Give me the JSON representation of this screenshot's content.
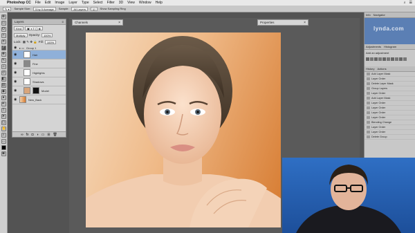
{
  "menubar": {
    "app_name": "Photoshop CC",
    "items": [
      "File",
      "Edit",
      "Image",
      "Layer",
      "Type",
      "Select",
      "Filter",
      "3D",
      "View",
      "Window",
      "Help"
    ]
  },
  "options": {
    "sample_size_label": "Sample Size:",
    "sample_size_value": "5 by 5 Average",
    "sample_label": "Sample:",
    "sample_value": "All Layers",
    "ring_label": "Show Sampling Ring"
  },
  "tabs": {
    "layers": "Layers",
    "channels": "Channels",
    "properties": "Properties"
  },
  "layers_panel": {
    "kind_value": "Kind",
    "blend_mode": "Multiply",
    "opacity_label": "Opacity:",
    "opacity_value": "100%",
    "lock_label": "Lock:",
    "fill_label": "Fill:",
    "fill_value": "100%",
    "rows": [
      {
        "name": "Group 1",
        "type": "group"
      },
      {
        "name": "Hair",
        "type": "layer",
        "selected": true
      },
      {
        "name": "Fine",
        "type": "layer"
      },
      {
        "name": "Highlights",
        "type": "layer"
      },
      {
        "name": "Shadows",
        "type": "layer"
      },
      {
        "name": "Model",
        "type": "mask"
      },
      {
        "name": "New_Back",
        "type": "layer"
      }
    ]
  },
  "right_panel": {
    "info_tab": "Info",
    "navigator_tab": "Navigator",
    "adjustments_tab": "Adjustments",
    "histogram_tab": "Histogram",
    "add_adjustment": "Add an adjustment",
    "history_tab": "History",
    "actions_tab": "Actions",
    "history_items": [
      "Add Layer Mask",
      "Layer Order",
      "Delete Layer Mask",
      "Group Layers",
      "Layer Order",
      "Add Layer Mask",
      "Layer Order",
      "Layer Order",
      "Layer Order",
      "Layer Order",
      "Blending Change",
      "Layer Order",
      "Layer Order",
      "Delete Group"
    ]
  },
  "watermark": "lynda.com",
  "colors": {
    "selected_layer": "#8fb0d9",
    "webcam_bg": "#2f6fc4",
    "canvas_orange": "#d67a2f"
  }
}
